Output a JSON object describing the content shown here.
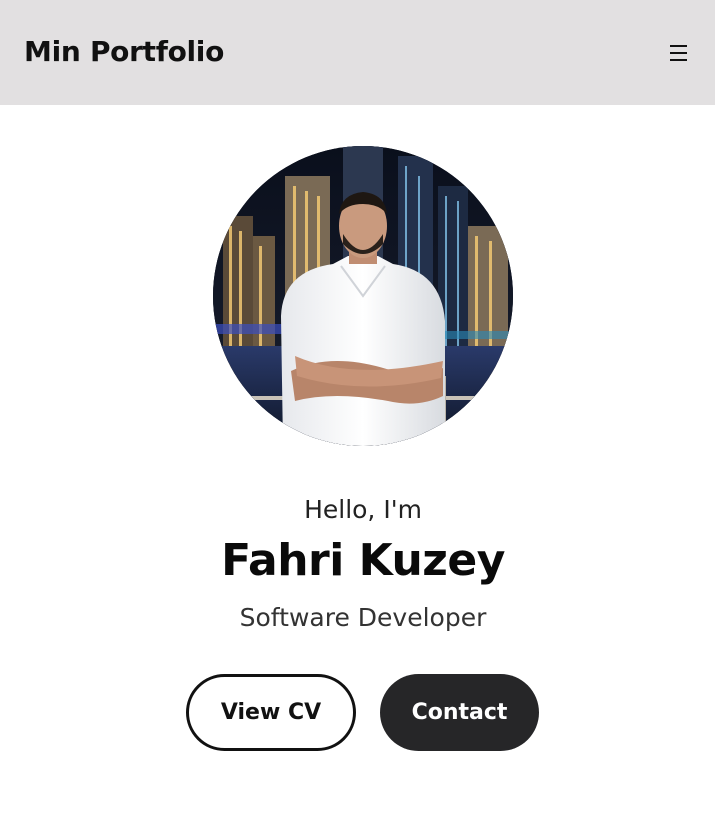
{
  "header": {
    "title": "Min Portfolio",
    "menu_icon": "hamburger-menu-icon",
    "background": "#e2e0e1"
  },
  "hero": {
    "avatar_alt": "profile photo",
    "greeting": "Hello, I'm",
    "name": "Fahri Kuzey",
    "role": "Software Developer"
  },
  "actions": {
    "view_cv_label": "View CV",
    "contact_label": "Contact"
  },
  "colors": {
    "text_primary": "#111111",
    "button_dark": "#262628",
    "button_light": "#ffffff"
  }
}
